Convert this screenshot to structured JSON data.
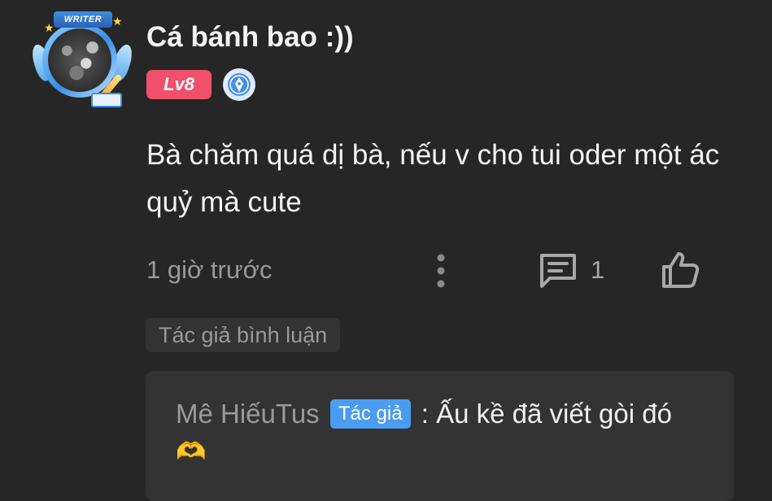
{
  "comment": {
    "avatar_frame_label": "WRITER",
    "username": "Cá bánh bao :))",
    "level": "Lv8",
    "text": "Bà chăm quá dị bà, nếu v cho tui oder một ác quỷ mà cute",
    "timestamp": "1 giờ trước",
    "reply_count": "1",
    "author_comment_tag": "Tác giả bình luận"
  },
  "reply": {
    "username": "Mê HiếuTus",
    "badge": "Tác giả",
    "separator": ":",
    "text": "Ấu kề đã viết gòi đó",
    "emoji": "🫶"
  },
  "colors": {
    "background": "#262626",
    "level_badge": "#f0506a",
    "author_badge": "#4a9cf0",
    "muted_text": "#9a9a9a",
    "panel": "#333333"
  },
  "icons": [
    "writer-avatar-frame",
    "author-pen-icon",
    "more-vertical-icon",
    "reply-comment-icon",
    "thumbs-up-icon",
    "heart-hands-emoji"
  ]
}
